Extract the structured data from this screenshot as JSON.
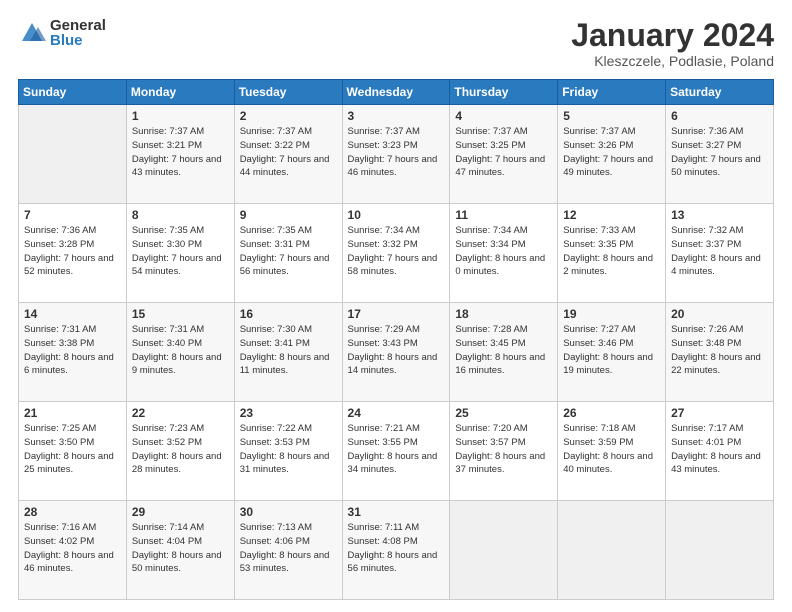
{
  "logo": {
    "general": "General",
    "blue": "Blue"
  },
  "title": "January 2024",
  "location": "Kleszczele, Podlasie, Poland",
  "days_header": [
    "Sunday",
    "Monday",
    "Tuesday",
    "Wednesday",
    "Thursday",
    "Friday",
    "Saturday"
  ],
  "weeks": [
    [
      {
        "day": "",
        "info": ""
      },
      {
        "day": "1",
        "info": "Sunrise: 7:37 AM\nSunset: 3:21 PM\nDaylight: 7 hours\nand 43 minutes."
      },
      {
        "day": "2",
        "info": "Sunrise: 7:37 AM\nSunset: 3:22 PM\nDaylight: 7 hours\nand 44 minutes."
      },
      {
        "day": "3",
        "info": "Sunrise: 7:37 AM\nSunset: 3:23 PM\nDaylight: 7 hours\nand 46 minutes."
      },
      {
        "day": "4",
        "info": "Sunrise: 7:37 AM\nSunset: 3:25 PM\nDaylight: 7 hours\nand 47 minutes."
      },
      {
        "day": "5",
        "info": "Sunrise: 7:37 AM\nSunset: 3:26 PM\nDaylight: 7 hours\nand 49 minutes."
      },
      {
        "day": "6",
        "info": "Sunrise: 7:36 AM\nSunset: 3:27 PM\nDaylight: 7 hours\nand 50 minutes."
      }
    ],
    [
      {
        "day": "7",
        "info": "Sunrise: 7:36 AM\nSunset: 3:28 PM\nDaylight: 7 hours\nand 52 minutes."
      },
      {
        "day": "8",
        "info": "Sunrise: 7:35 AM\nSunset: 3:30 PM\nDaylight: 7 hours\nand 54 minutes."
      },
      {
        "day": "9",
        "info": "Sunrise: 7:35 AM\nSunset: 3:31 PM\nDaylight: 7 hours\nand 56 minutes."
      },
      {
        "day": "10",
        "info": "Sunrise: 7:34 AM\nSunset: 3:32 PM\nDaylight: 7 hours\nand 58 minutes."
      },
      {
        "day": "11",
        "info": "Sunrise: 7:34 AM\nSunset: 3:34 PM\nDaylight: 8 hours\nand 0 minutes."
      },
      {
        "day": "12",
        "info": "Sunrise: 7:33 AM\nSunset: 3:35 PM\nDaylight: 8 hours\nand 2 minutes."
      },
      {
        "day": "13",
        "info": "Sunrise: 7:32 AM\nSunset: 3:37 PM\nDaylight: 8 hours\nand 4 minutes."
      }
    ],
    [
      {
        "day": "14",
        "info": "Sunrise: 7:31 AM\nSunset: 3:38 PM\nDaylight: 8 hours\nand 6 minutes."
      },
      {
        "day": "15",
        "info": "Sunrise: 7:31 AM\nSunset: 3:40 PM\nDaylight: 8 hours\nand 9 minutes."
      },
      {
        "day": "16",
        "info": "Sunrise: 7:30 AM\nSunset: 3:41 PM\nDaylight: 8 hours\nand 11 minutes."
      },
      {
        "day": "17",
        "info": "Sunrise: 7:29 AM\nSunset: 3:43 PM\nDaylight: 8 hours\nand 14 minutes."
      },
      {
        "day": "18",
        "info": "Sunrise: 7:28 AM\nSunset: 3:45 PM\nDaylight: 8 hours\nand 16 minutes."
      },
      {
        "day": "19",
        "info": "Sunrise: 7:27 AM\nSunset: 3:46 PM\nDaylight: 8 hours\nand 19 minutes."
      },
      {
        "day": "20",
        "info": "Sunrise: 7:26 AM\nSunset: 3:48 PM\nDaylight: 8 hours\nand 22 minutes."
      }
    ],
    [
      {
        "day": "21",
        "info": "Sunrise: 7:25 AM\nSunset: 3:50 PM\nDaylight: 8 hours\nand 25 minutes."
      },
      {
        "day": "22",
        "info": "Sunrise: 7:23 AM\nSunset: 3:52 PM\nDaylight: 8 hours\nand 28 minutes."
      },
      {
        "day": "23",
        "info": "Sunrise: 7:22 AM\nSunset: 3:53 PM\nDaylight: 8 hours\nand 31 minutes."
      },
      {
        "day": "24",
        "info": "Sunrise: 7:21 AM\nSunset: 3:55 PM\nDaylight: 8 hours\nand 34 minutes."
      },
      {
        "day": "25",
        "info": "Sunrise: 7:20 AM\nSunset: 3:57 PM\nDaylight: 8 hours\nand 37 minutes."
      },
      {
        "day": "26",
        "info": "Sunrise: 7:18 AM\nSunset: 3:59 PM\nDaylight: 8 hours\nand 40 minutes."
      },
      {
        "day": "27",
        "info": "Sunrise: 7:17 AM\nSunset: 4:01 PM\nDaylight: 8 hours\nand 43 minutes."
      }
    ],
    [
      {
        "day": "28",
        "info": "Sunrise: 7:16 AM\nSunset: 4:02 PM\nDaylight: 8 hours\nand 46 minutes."
      },
      {
        "day": "29",
        "info": "Sunrise: 7:14 AM\nSunset: 4:04 PM\nDaylight: 8 hours\nand 50 minutes."
      },
      {
        "day": "30",
        "info": "Sunrise: 7:13 AM\nSunset: 4:06 PM\nDaylight: 8 hours\nand 53 minutes."
      },
      {
        "day": "31",
        "info": "Sunrise: 7:11 AM\nSunset: 4:08 PM\nDaylight: 8 hours\nand 56 minutes."
      },
      {
        "day": "",
        "info": ""
      },
      {
        "day": "",
        "info": ""
      },
      {
        "day": "",
        "info": ""
      }
    ]
  ]
}
